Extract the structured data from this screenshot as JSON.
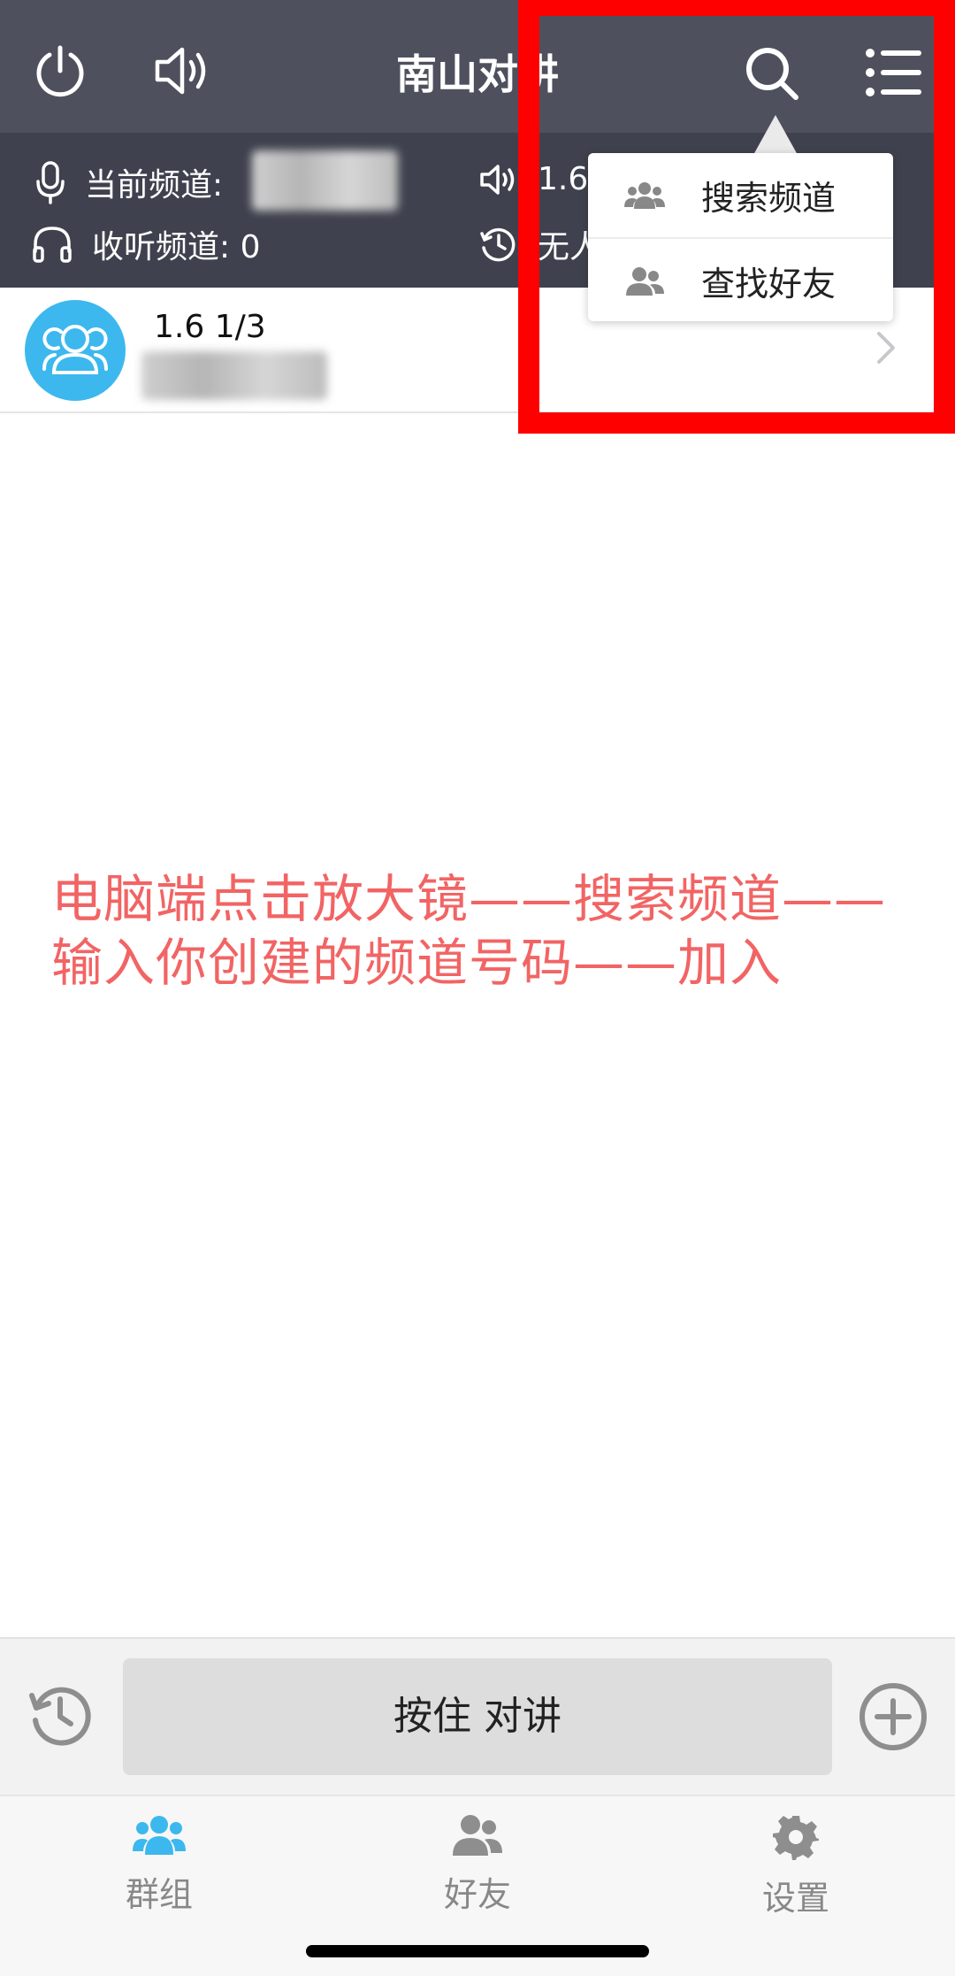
{
  "header": {
    "title": "南山对讲",
    "icons": [
      "power-icon",
      "speaker-icon",
      "search-icon",
      "menu-list-icon"
    ]
  },
  "info": {
    "current_channel_label": "当前频道:",
    "listen_channel_label": "收听频道: 0",
    "speaker_value": "1.6",
    "history_text": "无人"
  },
  "channel_list": [
    {
      "name": "1.6 1/3"
    }
  ],
  "dropdown": {
    "items": [
      {
        "label": "搜索频道",
        "icon": "group-icon"
      },
      {
        "label": "查找好友",
        "icon": "friends-icon"
      }
    ]
  },
  "annotation": {
    "text": "电脑端点击放大镜——搜索频道——输入你创建的频道号码——加入",
    "color": "#f26464"
  },
  "ptt": {
    "button_label": "按住 对讲"
  },
  "tabs": [
    {
      "label": "群组",
      "active": true
    },
    {
      "label": "好友",
      "active": false
    },
    {
      "label": "设置",
      "active": false
    }
  ],
  "colors": {
    "accent": "#3cb8ee",
    "header": "#4e515d",
    "highlight_box": "#ff0000"
  }
}
